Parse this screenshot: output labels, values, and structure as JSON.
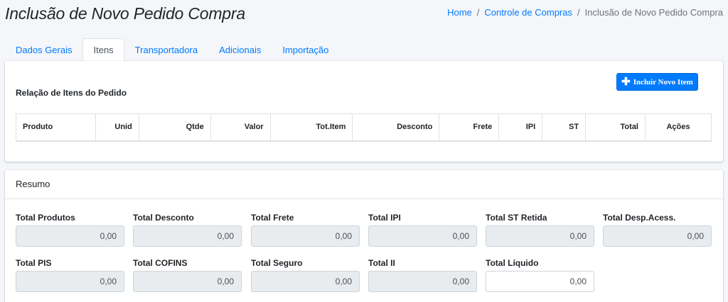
{
  "page": {
    "title": "Inclusão de Novo Pedido Compra"
  },
  "breadcrumb": {
    "home": "Home",
    "compras": "Controle de Compras",
    "current": "Inclusão de Novo Pedido Compra",
    "sep": "/"
  },
  "tabs": [
    "Dados Gerais",
    "Itens",
    "Transportadora",
    "Adicionais",
    "Importação"
  ],
  "items": {
    "title": "Relação de Itens do Pedido",
    "add_button": "Incluir Novo Item",
    "add_icon": "plus-icon",
    "columns": [
      "Produto",
      "Unid",
      "Qtde",
      "Valor",
      "Tot.Item",
      "Desconto",
      "Frete",
      "IPI",
      "ST",
      "Total",
      "Ações"
    ]
  },
  "resumo": {
    "title": "Resumo",
    "fields": [
      {
        "label": "Total Produtos",
        "value": "0,00"
      },
      {
        "label": "Total Desconto",
        "value": "0,00"
      },
      {
        "label": "Total Frete",
        "value": "0,00"
      },
      {
        "label": "Total IPI",
        "value": "0,00"
      },
      {
        "label": "Total ST Retida",
        "value": "0,00"
      },
      {
        "label": "Total Desp.Acess.",
        "value": "0,00"
      },
      {
        "label": "Total PIS",
        "value": "0,00"
      },
      {
        "label": "Total COFINS",
        "value": "0,00"
      },
      {
        "label": "Total Seguro",
        "value": "0,00"
      },
      {
        "label": "Total II",
        "value": "0,00"
      },
      {
        "label": "Total Líquido",
        "value": "0,00"
      }
    ]
  },
  "colors": {
    "primary": "#007bff",
    "readonly_bg": "#e9ecef",
    "page_bg": "#f4f6f9"
  }
}
